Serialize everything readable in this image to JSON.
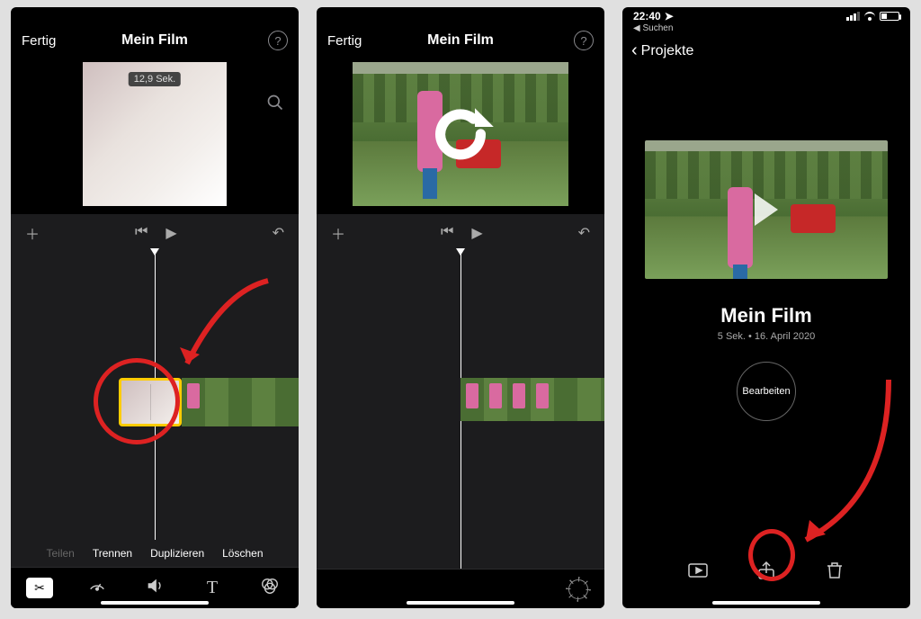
{
  "panel1": {
    "done": "Fertig",
    "title": "Mein Film",
    "duration_badge": "12,9 Sek.",
    "actions": {
      "split": "Teilen",
      "cut": "Trennen",
      "duplicate": "Duplizieren",
      "delete": "Löschen"
    }
  },
  "panel2": {
    "done": "Fertig",
    "title": "Mein Film"
  },
  "panel3": {
    "status_time": "22:40",
    "back_app": "Suchen",
    "back_nav": "Projekte",
    "project_title": "Mein Film",
    "project_meta": "5 Sek. • 16. April 2020",
    "edit": "Bearbeiten"
  }
}
